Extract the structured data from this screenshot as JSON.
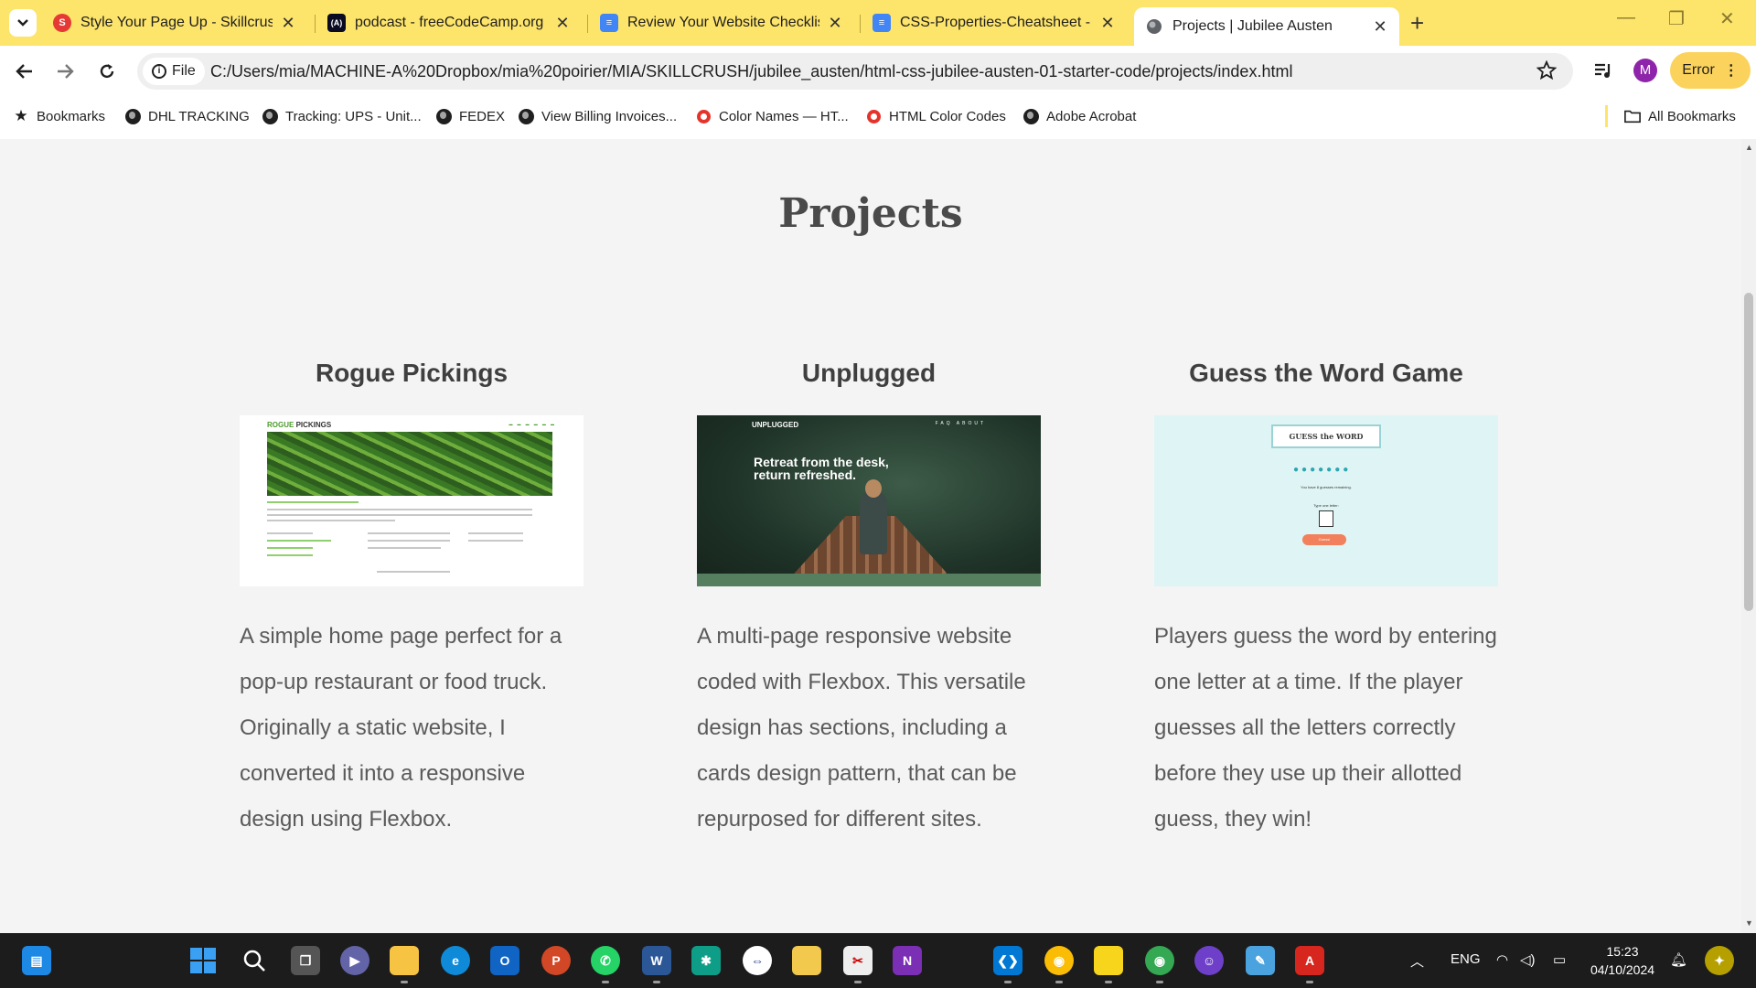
{
  "browser": {
    "tabs": [
      {
        "title": "Style Your Page Up - Skillcrush",
        "favicon_color": "#e53935",
        "favicon": "S"
      },
      {
        "title": "podcast - freeCodeCamp.org",
        "favicon_color": "#0a0a23",
        "favicon": "(A)"
      },
      {
        "title": "Review Your Website Checklist -",
        "favicon_color": "#4285f4",
        "favicon": "≡"
      },
      {
        "title": "CSS-Properties-Cheatsheet - Go",
        "favicon_color": "#4285f4",
        "favicon": "≡"
      },
      {
        "title": "Projects | Jubilee Austen",
        "favicon_color": "#5f6368",
        "favicon": "◍"
      }
    ],
    "active_tab_index": 4,
    "new_tab": "+",
    "url_chip": "File",
    "url": "C:/Users/mia/MACHINE-A%20Dropbox/mia%20poirier/MIA/SKILLCRUSH/jubilee_austen/html-css-jubilee-austen-01-starter-code/projects/index.html",
    "profile_initial": "M",
    "error_button": "Error",
    "bookmarks": [
      {
        "label": "Bookmarks",
        "icon": "star-icon"
      },
      {
        "label": "DHL TRACKING",
        "icon": "globe-icon"
      },
      {
        "label": "Tracking: UPS - Unit...",
        "icon": "globe-icon"
      },
      {
        "label": "FEDEX",
        "icon": "globe-icon"
      },
      {
        "label": "View Billing Invoices...",
        "icon": "globe-icon"
      },
      {
        "label": "Color Names — HT...",
        "icon": "red-ring-icon"
      },
      {
        "label": "HTML Color Codes",
        "icon": "red-ring-icon"
      },
      {
        "label": "Adobe Acrobat",
        "icon": "globe-icon"
      }
    ],
    "all_bookmarks": "All Bookmarks"
  },
  "page": {
    "title": "Projects",
    "projects": [
      {
        "name": "Rogue Pickings",
        "description": "A simple home page perfect for a pop-up restaurant or food truck. Originally a static website, I converted it into a responsive design using Flexbox.",
        "thumb": {
          "logo_a": "ROGUE",
          "logo_b": " PICKINGS"
        }
      },
      {
        "name": "Unplugged",
        "description": "A multi-page responsive website coded with Flexbox. This versatile design has sections, including a cards design pattern, that can be repurposed for different sites.",
        "thumb": {
          "brand": "UNPLUGGED",
          "nav": "FAQ  ABOUT",
          "headline_1": "Retreat from the desk,",
          "headline_2": "return refreshed."
        }
      },
      {
        "name": "Guess the Word Game",
        "description": "Players guess the word by entering one letter at a time. If the player guesses all the letters correctly before they use up their allotted guess, they win!",
        "thumb": {
          "banner": "GUESS the WORD",
          "dots": "●●●●●●●",
          "remaining": "You have 8 guesses remaining.",
          "prompt": "Type one letter:",
          "button": "Guess!"
        }
      }
    ]
  },
  "taskbar": {
    "language": "ENG",
    "time": "15:23",
    "date": "04/10/2024"
  },
  "colors": {
    "tab_bar": "#fde46a",
    "page_bg": "#f4f4f4",
    "heading": "#4a4a4a",
    "body_text": "#5a5a5a"
  }
}
